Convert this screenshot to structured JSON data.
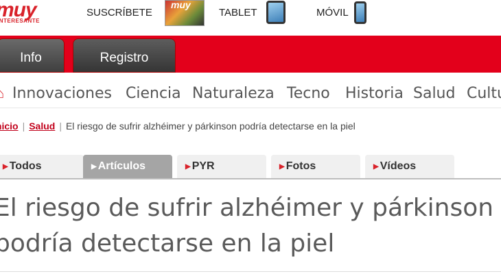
{
  "header": {
    "logo_text": "muy",
    "logo_sub": "INTERESANTE",
    "subscribe_label": "SUSCRÍBETE",
    "magazine_thumb_text": "muy",
    "tablet_label": "TABLET",
    "mobile_label": "MÓVIL",
    "brand_color": "#e3001b"
  },
  "tabs": {
    "info": "Info",
    "registro": "Registro"
  },
  "sections": [
    "Innovaciones",
    "Ciencia",
    "Naturaleza",
    "Tecno",
    "Historia",
    "Salud",
    "Cultura"
  ],
  "breadcrumb": {
    "home": "Inicio",
    "section": "Salud",
    "current": "El riesgo de sufrir alzhéimer y párkinson podría detectarse en la piel"
  },
  "content_tabs": [
    "Todos",
    "Artículos",
    "PYR",
    "Fotos",
    "Vídeos"
  ],
  "active_content_tab": "Artículos",
  "article": {
    "title_line1": "El riesgo de sufrir alzhéimer y párkinson",
    "title_line2": "podría detectarse en la piel"
  }
}
